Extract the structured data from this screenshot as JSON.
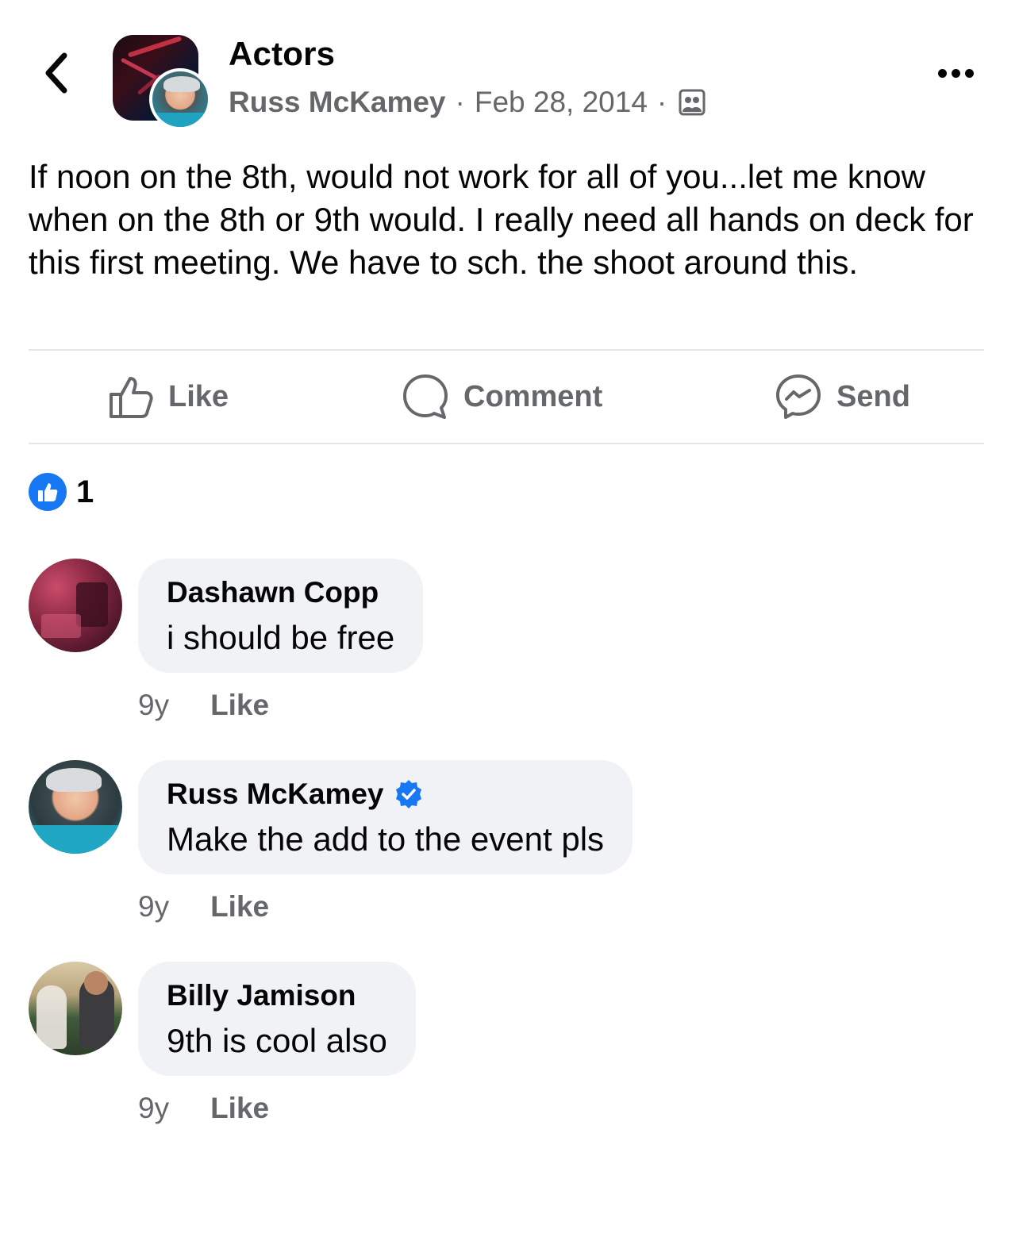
{
  "header": {
    "group_name": "Actors",
    "author": "Russ McKamey",
    "separator": "·",
    "date": "Feb 28, 2014",
    "audience_icon": "group-members-icon"
  },
  "post": {
    "text": "If noon on the 8th, would not work for all of you...let me know when on the 8th or 9th would. I really need all hands on deck for this first meeting. We have to sch. the shoot around this."
  },
  "actions": {
    "like": "Like",
    "comment": "Comment",
    "send": "Send"
  },
  "reactions": {
    "count": "1",
    "type_icon": "like-reaction-icon"
  },
  "comments": [
    {
      "name": "Dashawn Copp",
      "text": "i should be free",
      "age": "9y",
      "like": "Like",
      "verified": false
    },
    {
      "name": "Russ McKamey",
      "text": "Make the add to the event pls",
      "age": "9y",
      "like": "Like",
      "verified": true
    },
    {
      "name": "Billy Jamison",
      "text": "9th is cool also",
      "age": "9y",
      "like": "Like",
      "verified": false
    }
  ],
  "colors": {
    "accent": "#1877f2",
    "secondary_text": "#65676b",
    "bubble_bg": "#f0f2f5",
    "divider": "#e4e6eb"
  }
}
